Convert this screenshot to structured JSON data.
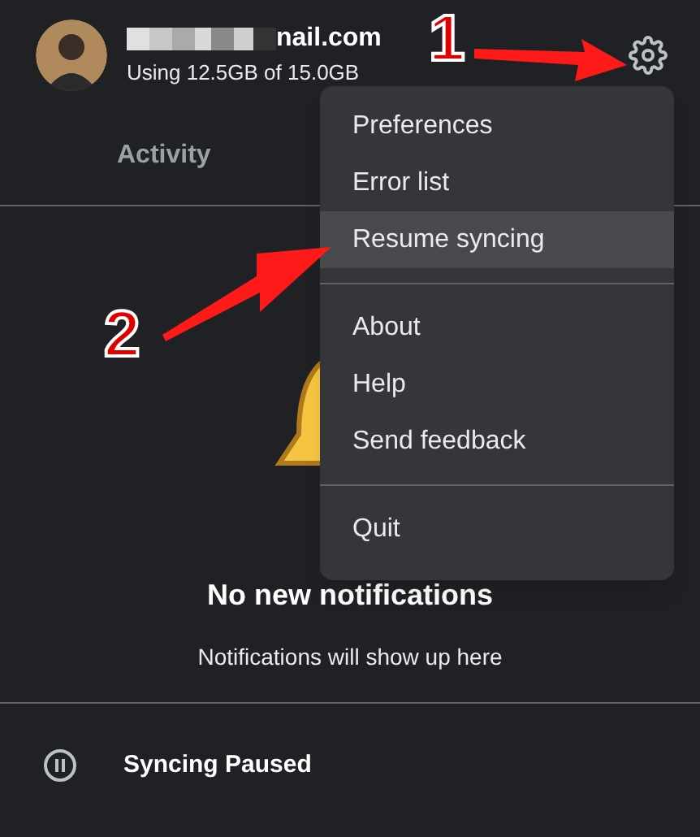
{
  "account": {
    "email": "nail.com",
    "storage": "Using 12.5GB of 15.0GB"
  },
  "tabs": [
    {
      "label": "Activity",
      "selected": false
    }
  ],
  "menu": {
    "groups": [
      [
        {
          "label": "Preferences",
          "selected": false
        },
        {
          "label": "Error list",
          "selected": false
        },
        {
          "label": "Resume syncing",
          "selected": true
        }
      ],
      [
        {
          "label": "About",
          "selected": false
        },
        {
          "label": "Help",
          "selected": false
        },
        {
          "label": "Send feedback",
          "selected": false
        }
      ],
      [
        {
          "label": "Quit",
          "selected": false
        }
      ]
    ]
  },
  "empty_state": {
    "title": "No new notifications",
    "subtitle": "Notifications will show up here"
  },
  "status_bar": {
    "label": "Syncing Paused"
  },
  "annotations": [
    {
      "label": "1"
    },
    {
      "label": "2"
    }
  ]
}
